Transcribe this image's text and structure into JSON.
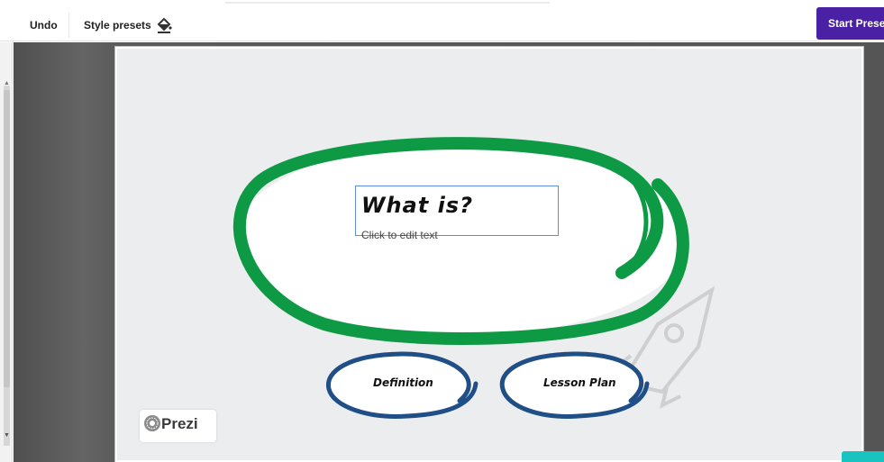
{
  "toolbar": {
    "undo_label": "Undo",
    "style_presets_label": "Style presets",
    "start_label": "Start Prese"
  },
  "slide": {
    "title": "What is?",
    "subtitle": "Click to edit text",
    "topics": [
      {
        "label": "Definition"
      },
      {
        "label": "Lesson Plan"
      }
    ],
    "logo_text": "Prezi"
  },
  "colors": {
    "accent": "#4a20a4",
    "main_bubble": "#0e9a45",
    "topic_bubble": "#1f4f86",
    "teal": "#19c4c0"
  },
  "icons": {
    "fill": "paint-bucket-icon",
    "logo": "prezi-logo-icon",
    "decor": "rocket-icon"
  }
}
